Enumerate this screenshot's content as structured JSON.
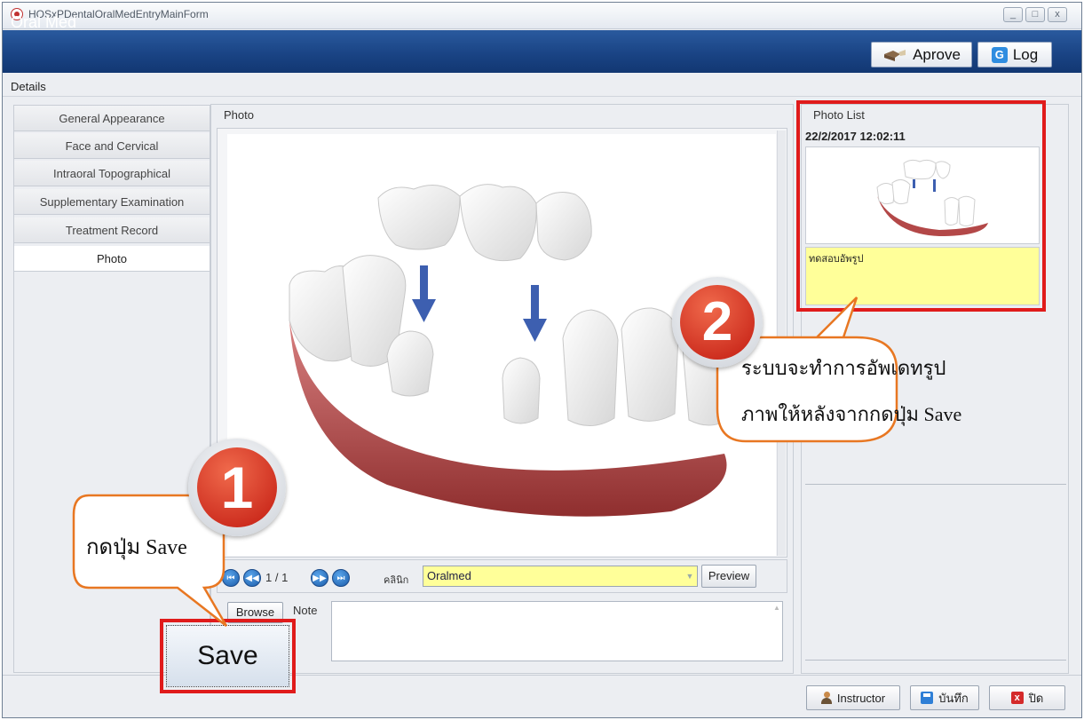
{
  "window": {
    "title": "HOSxPDentalOralMedEntryMainForm",
    "min": "_",
    "max": "□",
    "close": "x"
  },
  "header": {
    "title": "Oral Med",
    "approve_label": "Aprove",
    "log_label": "Log"
  },
  "details_label": "Details",
  "tabs": [
    {
      "label": "General Appearance"
    },
    {
      "label": "Face and Cervical"
    },
    {
      "label": "Intraoral Topographical"
    },
    {
      "label": "Supplementary Examination"
    },
    {
      "label": "Treatment Record"
    },
    {
      "label": "Photo",
      "active": true
    }
  ],
  "photo": {
    "caption": "Photo",
    "page_counter": "1 / 1",
    "clinic_label": "คลินิก",
    "clinic_value": "Oralmed",
    "preview_label": "Preview",
    "browse_label": "Browse",
    "note_label": "Note"
  },
  "photo_list": {
    "caption": "Photo List",
    "date": "22/2/2017 12:02:11",
    "note": "ทดสอบอัพรูป"
  },
  "save_label": "Save",
  "bottom": {
    "instructor_label": "Instructor",
    "save_th_label": "บันทึก",
    "close_th_label": "ปิด"
  },
  "annotations": {
    "step1_number": "1",
    "step1_text": "กดปุ่ม Save",
    "step2_number": "2",
    "step2_line1": "ระบบจะทำการอัพเดทรูป",
    "step2_line2": "ภาพให้หลังจากกดปุ่ม Save"
  },
  "colors": {
    "header_blue": "#1a4485",
    "highlight_red": "#e01b1b",
    "field_yellow": "#ffff99",
    "badge_red": "#d42a1c",
    "bubble_border": "#e87722"
  }
}
